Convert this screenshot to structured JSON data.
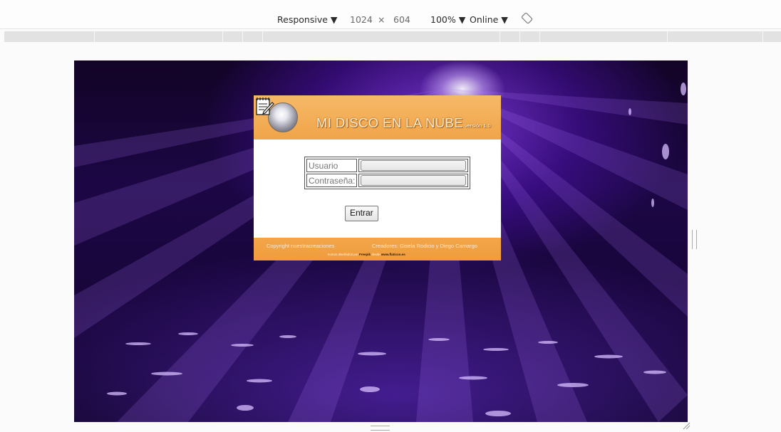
{
  "toolbar": {
    "device_label": "Responsive ▼",
    "width": "1024",
    "times": "×",
    "height": "604",
    "zoom_label": "100% ▼",
    "network_label": "Online ▼"
  },
  "page": {
    "header_title": "MI DISCO EN LA NUBE",
    "header_version": "versión 1.0",
    "form": {
      "user_label": "Usuario",
      "user_value": "",
      "password_label": "Contraseña:",
      "password_value": "",
      "submit_label": "Entrar"
    },
    "footer": {
      "copyright": "Copyright nuestracreaciones",
      "creators": "Creadores: Gisela Rodicio y Diego Camargo",
      "credit_prefix": "Iconos diseñados por",
      "credit_author": "Freepik",
      "credit_mid": "desde",
      "credit_site": "www.flaticon.es"
    }
  },
  "colors": {
    "accent_orange": "#f0a449",
    "background_purple": "#1c0745"
  }
}
